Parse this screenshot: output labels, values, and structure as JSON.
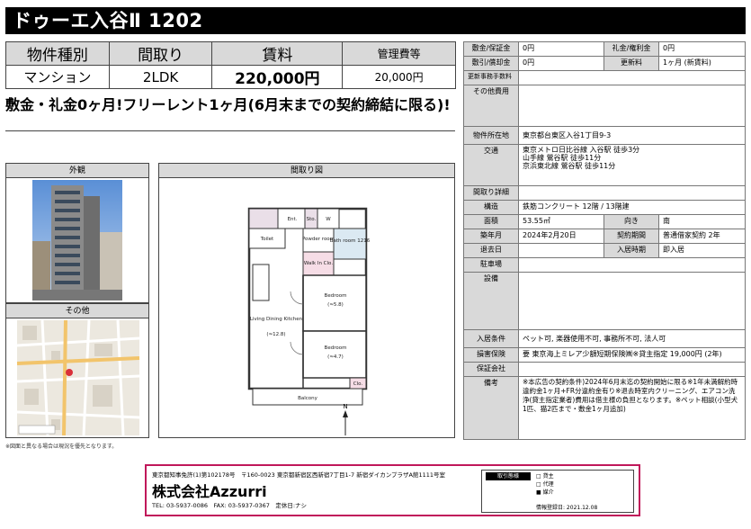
{
  "title": "ドゥーエ入谷Ⅱ 1202",
  "summary": {
    "headers": [
      "物件種別",
      "間取り",
      "賃料",
      "管理費等"
    ],
    "values": [
      "マンション",
      "2LDK",
      "220,000円",
      "20,000円"
    ]
  },
  "catch_copy": "敷金・礼金0ヶ月!フリーレント1ヶ月(6月末までの契約締結に限る)!",
  "details": {
    "shikikin_label": "敷金/保証金",
    "shikikin_value": "0円",
    "reikin_label": "礼金/権利金",
    "reikin_value": "0円",
    "shikibiki_label": "敷引/償却金",
    "shikibiki_value": "0円",
    "koushin_label": "更新料",
    "koushin_value": "1ヶ月 (新賃料)",
    "koushin_jimu_label": "更新事務手数料",
    "koushin_jimu_value": "",
    "sonota_label": "その他費用",
    "sonota_value": "",
    "shozaichi_label": "物件所在地",
    "shozaichi_value": "東京都台東区入谷1丁目9-3",
    "koutsu_label": "交通",
    "koutsu_lines": [
      "東京メトロ日比谷線 入谷駅 徒歩3分",
      "山手線 鶯谷駅 徒歩11分",
      "京浜東北線 鶯谷駅 徒歩11分"
    ],
    "madori_shousai_label": "間取り詳細",
    "madori_shousai_value": "",
    "kouzou_label": "構造",
    "kouzou_value": "鉄筋コンクリート 12階 / 13階建",
    "menseki_label": "面積",
    "menseki_value": "53.55㎡",
    "muki_label": "向き",
    "muki_value": "南",
    "chikunen_label": "築年月",
    "chikunen_value": "2024年2月20日",
    "keiyaku_label": "契約期間",
    "keiyaku_value": "普通借家契約 2年",
    "taikyo_label": "退去日",
    "taikyo_value": "",
    "nyukyo_label": "入居時期",
    "nyukyo_value": "即入居",
    "chushajo_label": "駐車場",
    "chushajo_value": "",
    "setsubi_label": "設備",
    "setsubi_value": "",
    "jouken_label": "入居条件",
    "jouken_value": "ペット可, 楽器使用不可, 事務所不可, 法人可",
    "hoken_label": "損害保険",
    "hoken_value": "要 東京海上ミレア少額短期保険㈱※貸主指定 19,000円 (2年)",
    "hoshou_label": "保証会社",
    "hoshou_value": "",
    "bikou_label": "備考",
    "bikou_value": "※本広告の契約条件)2024年6月末迄の契約開始に限る※1年未満解約時違約金1ヶ月+FR分違約金有り※退去時室内クリーニング、エアコン洗浄(貸主指定業者)費用は借主様の負担となります。※ペット相談(小型犬1匹、猫2匹まで・敷金1ヶ月追加)"
  },
  "panels": {
    "exterior_title": "外観",
    "floorplan_title": "間取り図",
    "other_title": "その他",
    "note": "※図面と異なる場合は現況を優先となります。"
  },
  "floorplan_labels": {
    "ent": "Ent.",
    "sto": "Sto.",
    "wm": "W",
    "toilet": "Toilet",
    "powder": "Powder room",
    "bath": "Bath room 1216",
    "walkin": "Walk In Clo.",
    "ldk": "Living Dining Kitchen",
    "ldk_size": "(≈12.8)",
    "bed1": "Bedroom",
    "bed1_size": "(≈5.8)",
    "bed2": "Bedroom",
    "bed2_size": "(≈4.7)",
    "clo": "Clo.",
    "balcony": "Balcony",
    "north": "N"
  },
  "footer": {
    "license_line": "東京都知事免許(1)第102178号　〒160-0023 東京都新宿区西新宿7丁目1-7 新宿ダイカンプラザA館1111号室",
    "company": "株式会社Azzurri",
    "contact_line": "TEL: 03-5937-0086　FAX: 03-5937-0367　定休日:ナシ",
    "stamp_header": "取引態様",
    "stamp_rows": [
      "□ 貸主",
      "□ 代理",
      "■ 媒介"
    ],
    "info_date": "情報登録日: 2021.12.08"
  },
  "colors": {
    "accent": "#c0185a",
    "header_bg": "#d9d9d9",
    "title_bg": "#000000"
  }
}
